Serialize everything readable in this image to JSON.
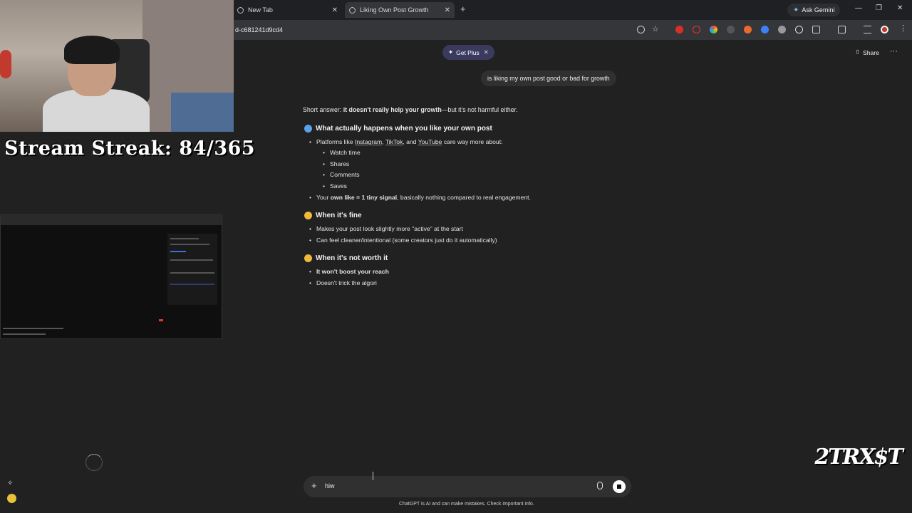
{
  "browser": {
    "tabs": [
      {
        "label": "New Tab"
      },
      {
        "label": "Liking Own Post Growth"
      }
    ],
    "new_tab_label": "+",
    "ask_gemini": "Ask Gemini",
    "url": "d-c681241d9cd4"
  },
  "chat": {
    "get_plus": "Get Plus",
    "share": "Share",
    "user_message": "is liking my own post good or bad for growth",
    "intro_prefix": "Short answer: ",
    "intro_bold": "it doesn't really help your growth",
    "intro_suffix": "—but it's not harmful either.",
    "section1_title": "What actually happens when you like your own post",
    "s1_item1_pre": "Platforms like ",
    "s1_item1_ig": "Instagram",
    "s1_item1_sep1": ", ",
    "s1_item1_tt": "TikTok",
    "s1_item1_sep2": ", and ",
    "s1_item1_yt": "YouTube",
    "s1_item1_post": " care way more about:",
    "s1_sub": [
      "Watch time",
      "Shares",
      "Comments",
      "Saves"
    ],
    "s1_item2_pre": "Your ",
    "s1_item2_bold": "own like = 1 tiny signal",
    "s1_item2_post": ", basically nothing compared to real engagement.",
    "section2_title": "When it's fine",
    "s2_items": [
      "Makes your post look slightly more \"active\" at the start",
      "Can feel cleaner/intentional (some creators just do it automatically)"
    ],
    "section3_title": "When it's not worth it",
    "s3_item1": "It won't boost your reach",
    "s3_item2": "Doesn't trick the algori",
    "composer_text": "hiw",
    "disclaimer": "ChatGPT is AI and can make mistakes. Check important info."
  },
  "overlay": {
    "streak": "Stream Streak: 84/365",
    "logo": "2TRX$T"
  },
  "colors": {
    "bg": "#212121",
    "bubble": "#303030",
    "getplus": "#3a3a5e"
  }
}
